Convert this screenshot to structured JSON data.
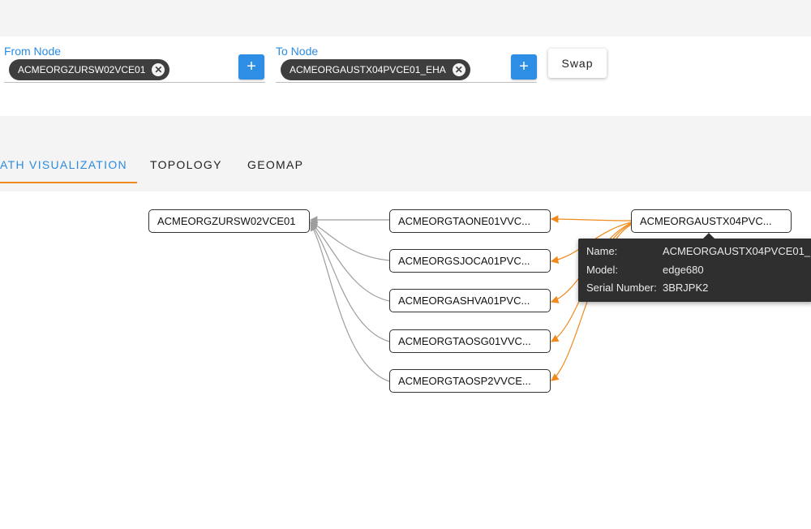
{
  "filters": {
    "from": {
      "label": "From Node",
      "chip": "ACMEORGZURSW02VCE01",
      "add_label": "+"
    },
    "to": {
      "label": "To Node",
      "chip": "ACMEORGAUSTX04PVCE01_EHA",
      "add_label": "+"
    },
    "swap_label": "Swap",
    "chip_remove_glyph": "✕"
  },
  "tabs": [
    {
      "label": "ATH VISUALIZATION",
      "active": true
    },
    {
      "label": "TOPOLOGY",
      "active": false
    },
    {
      "label": "GEOMAP",
      "active": false
    }
  ],
  "graph": {
    "source": "ACMEORGZURSW02VCE01",
    "target": "ACMEORGAUSTX04PVC...",
    "hops": [
      "ACMEORGTAONE01VVC...",
      "ACMEORGSJOCA01PVC...",
      "ACMEORGASHVA01PVC...",
      "ACMEORGTAOSG01VVC...",
      "ACMEORGTAOSP2VVCE..."
    ],
    "colors": {
      "target_edge": "#f08a1c",
      "source_edge": "#9e9e9e"
    }
  },
  "tooltip": {
    "rows": [
      {
        "key": "Name:",
        "value": "ACMEORGAUSTX04PVCE01_"
      },
      {
        "key": "Model:",
        "value": "edge680"
      },
      {
        "key": "Serial Number:",
        "value": "3BRJPK2"
      }
    ]
  },
  "colors": {
    "accent": "#2a8be0",
    "tab_underline": "#f08a1c",
    "chip_bg": "#3e3e3e",
    "button_blue": "#2e8ee6"
  }
}
